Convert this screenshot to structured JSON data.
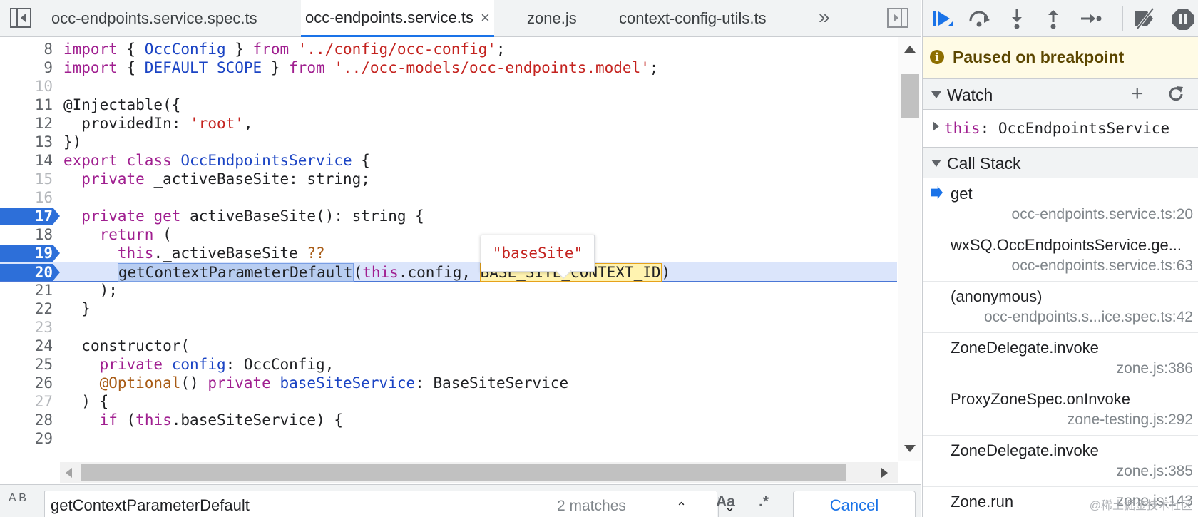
{
  "tabs": [
    {
      "label": "occ-endpoints.service.spec.ts",
      "active": false
    },
    {
      "label": "occ-endpoints.service.ts",
      "active": true,
      "close": "×"
    },
    {
      "label": "zone.js",
      "active": false
    },
    {
      "label": "context-config-utils.ts",
      "active": false
    }
  ],
  "more_tabs": "»",
  "code_lines": [
    {
      "n": "8"
    },
    {
      "n": "9"
    },
    {
      "n": "10"
    },
    {
      "n": "11"
    },
    {
      "n": "12"
    },
    {
      "n": "13"
    },
    {
      "n": "14"
    },
    {
      "n": "15"
    },
    {
      "n": "16"
    },
    {
      "n": "17"
    },
    {
      "n": "18"
    },
    {
      "n": "19"
    },
    {
      "n": "20"
    },
    {
      "n": "21"
    },
    {
      "n": "22"
    },
    {
      "n": "23"
    },
    {
      "n": "24"
    },
    {
      "n": "25"
    },
    {
      "n": "26"
    },
    {
      "n": "27"
    },
    {
      "n": "28"
    },
    {
      "n": "29"
    }
  ],
  "code_text": {
    "import": "import",
    "from": "from",
    "occconfig": "OccConfig",
    "occconfig_path": "'../config/occ-config'",
    "default_scope": "DEFAULT_SCOPE",
    "models_path": "'../occ-models/occ-endpoints.model'",
    "injectable": "@Injectable",
    "provided_in": "providedIn",
    "root": "'root'",
    "export": "export",
    "class": "class",
    "service_name": "OccEndpointsService",
    "private": "private",
    "active_base_site_field": "_activeBaseSite",
    "string": "string",
    "get": "get",
    "active_base_site": "activeBaseSite",
    "return": "return",
    "this": "this",
    "nullish": "??",
    "get_context": "getContextParameterDefault",
    "config": "config",
    "base_site_context": "BASE_SITE_CONTEXT_ID",
    "constructor": "constructor",
    "optional": "@Optional",
    "base_site_service": "baseSiteService",
    "base_site_service_type": "BaseSiteService",
    "if": "if"
  },
  "tooltip_value": "\"baseSite\"",
  "search": {
    "value": "getContextParameterDefault",
    "matches": "2 matches",
    "match_case": "Aa",
    "regex": ".*",
    "cancel": "Cancel",
    "replace_toggle": "A B"
  },
  "sidebar": {
    "paused": "Paused on breakpoint",
    "info_glyph": "i",
    "watch_title": "Watch",
    "watch_add": "+",
    "watch_key": "this",
    "watch_value": "OccEndpointsService",
    "callstack_title": "Call Stack",
    "frames": [
      {
        "fn": "get",
        "loc": "occ-endpoints.service.ts:20",
        "current": true
      },
      {
        "fn": "wxSQ.OccEndpointsService.ge...",
        "loc": "occ-endpoints.service.ts:63"
      },
      {
        "fn": "(anonymous)",
        "loc": "occ-endpoints.s...ice.spec.ts:42"
      },
      {
        "fn": "ZoneDelegate.invoke",
        "loc": "zone.js:386"
      },
      {
        "fn": "ProxyZoneSpec.onInvoke",
        "loc": "zone-testing.js:292"
      },
      {
        "fn": "ZoneDelegate.invoke",
        "loc": "zone.js:385"
      },
      {
        "fn": "Zone.run",
        "loc": "zone.js:143"
      }
    ]
  },
  "watermark": "@稀土掘金技术社区",
  "colors": {
    "accent": "#1a73e8",
    "breakpoint": "#2d6fd9",
    "keyword": "#a01f90",
    "string": "#c4231f",
    "type": "#1b44c4"
  }
}
